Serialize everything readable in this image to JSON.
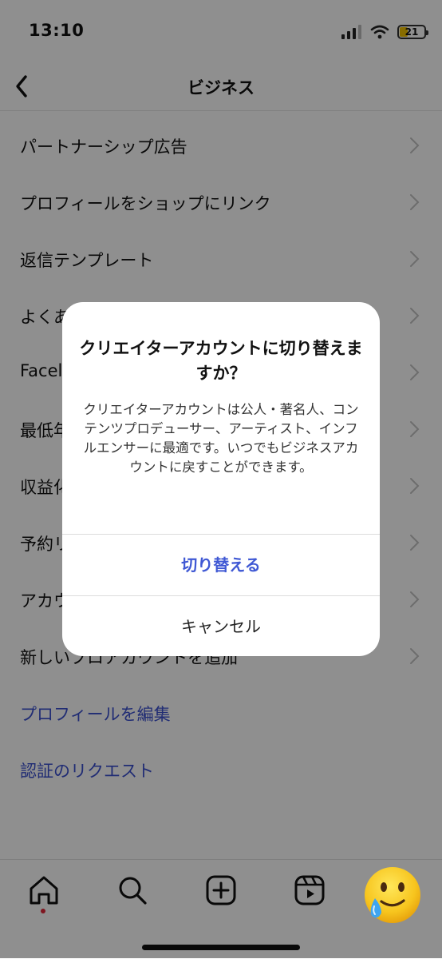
{
  "status_bar": {
    "time": "13:10",
    "battery_level": "21",
    "icons": [
      "signal-icon",
      "wifi-icon",
      "battery-icon"
    ]
  },
  "nav": {
    "title": "ビジネス",
    "back_icon": "chevron-left-icon"
  },
  "settings_list": {
    "items": [
      {
        "label": "パートナーシップ広告"
      },
      {
        "label": "プロフィールをショップにリンク"
      },
      {
        "label": "返信テンプレート"
      },
      {
        "label": "よくあ"
      },
      {
        "label": "Facel"
      },
      {
        "label": "最低年"
      },
      {
        "label": "収益化"
      },
      {
        "label": "予約リ"
      },
      {
        "label": "アカウ"
      },
      {
        "label": "新しいプロアカウントを追加"
      }
    ],
    "links": [
      {
        "label": "プロフィールを編集"
      },
      {
        "label": "認証のリクエスト"
      }
    ]
  },
  "dialog": {
    "title": "クリエイターアカウントに切り替えますか？",
    "message": "クリエイターアカウントは公人・著名人、コンテンツプロデューサー、アーティスト、インフルエンサーに最適です。いつでもビジネスアカウントに戻すことができます。",
    "primary_button": "切り替える",
    "cancel_button": "キャンセル"
  },
  "tab_bar": {
    "tabs": [
      "home-icon",
      "search-icon",
      "create-icon",
      "reels-icon",
      "profile-emoji-icon"
    ]
  },
  "colors": {
    "accent_link": "#3a4fcf",
    "primary_button": "#3f58d4",
    "overlay": "rgba(0,0,0,0.44)",
    "notification_dot": "#e2283a"
  }
}
